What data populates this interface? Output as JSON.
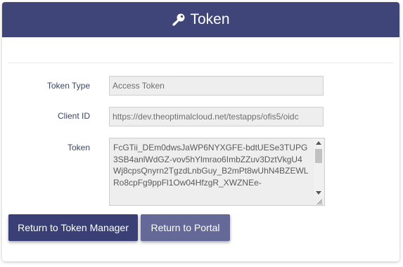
{
  "header": {
    "title": "Token",
    "icon": "key-icon",
    "background": "#3f4578"
  },
  "form": {
    "token_type": {
      "label": "Token Type",
      "value": "Access Token"
    },
    "client_id": {
      "label": "Client ID",
      "value": "https://dev.theoptimalcloud.net/testapps/ofis5/oidc"
    },
    "token": {
      "label": "Token",
      "value": "FcGTii_DEm0dwsJaWP6NYXGFE-bdtUESe3TUPG3SB4anlWdGZ-vov5hYlmrao6ImbZZuv3DztVkgU4Wj8cpsQnyrn2TgzdLnbGuy_B2mPt8wUhN4BZEWLRo8cpFg9ppFl1Ow04HfzgR_XWZNEe-"
    }
  },
  "actions": {
    "return_token_manager": "Return to Token Manager",
    "return_portal": "Return to Portal"
  },
  "colors": {
    "primary": "#3a4075",
    "secondary": "#646997"
  }
}
